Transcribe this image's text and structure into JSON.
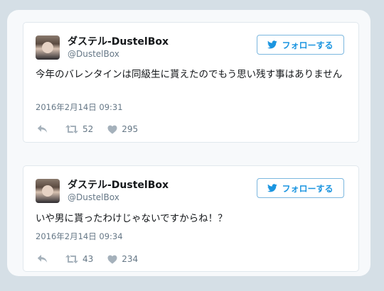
{
  "tweets": [
    {
      "display_name": "ダステル-DustelBox",
      "handle": "@DustelBox",
      "follow_label": "フォローする",
      "text": "今年のバレンタインは同級生に貰えたのでもう思い残す事はありません",
      "date": "2016年2月14日 09:31",
      "retweets": "52",
      "likes": "295"
    },
    {
      "display_name": "ダステル-DustelBox",
      "handle": "@DustelBox",
      "follow_label": "フォローする",
      "text": "いや男に貰ったわけじゃないですからね！？",
      "date": "2016年2月14日 09:34",
      "retweets": "43",
      "likes": "234"
    }
  ],
  "colors": {
    "accent": "#1b95e0",
    "follow_border": "#7bb7df",
    "muted_text": "#657786",
    "icon_gray": "#a5b1bb",
    "background": "#d5dfe6"
  },
  "icons": [
    "twitter-bird-icon",
    "reply-icon",
    "retweet-icon",
    "heart-icon"
  ]
}
